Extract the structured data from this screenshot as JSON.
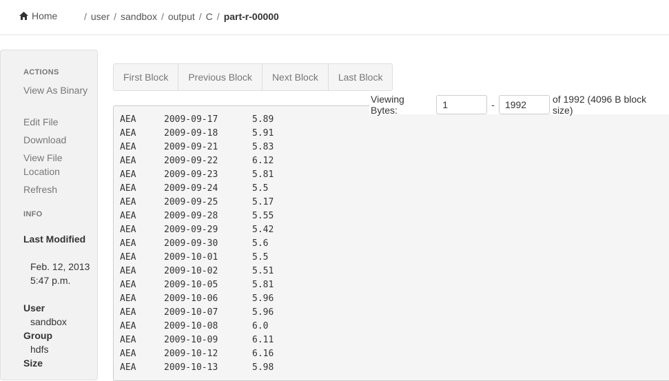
{
  "header": {
    "home_label": "Home",
    "breadcrumbs": [
      {
        "label": "user"
      },
      {
        "label": "sandbox"
      },
      {
        "label": "output"
      },
      {
        "label": "C"
      }
    ],
    "current_file": "part-r-00000",
    "separator": "/"
  },
  "sidebar": {
    "actions_title": "ACTIONS",
    "actions": [
      "View As Binary",
      "Edit File",
      "Download",
      "View File Location",
      "Refresh"
    ],
    "info_title": "INFO",
    "info": {
      "last_modified_label": "Last Modified",
      "last_modified_value": "Feb. 12, 2013 5:47 p.m.",
      "user_label": "User",
      "user_value": "sandbox",
      "group_label": "Group",
      "group_value": "hdfs",
      "size_label": "Size"
    }
  },
  "pager": {
    "first": "First Block",
    "previous": "Previous Block",
    "next": "Next Block",
    "last": "Last Block"
  },
  "viewing": {
    "label": "Viewing Bytes:",
    "start": "1",
    "dash": "-",
    "end": "1992",
    "suffix": "of 1992 (4096 B block size)"
  },
  "file_rows": [
    [
      "AEA",
      "2009-09-17",
      "5.89"
    ],
    [
      "AEA",
      "2009-09-18",
      "5.91"
    ],
    [
      "AEA",
      "2009-09-21",
      "5.83"
    ],
    [
      "AEA",
      "2009-09-22",
      "6.12"
    ],
    [
      "AEA",
      "2009-09-23",
      "5.81"
    ],
    [
      "AEA",
      "2009-09-24",
      "5.5"
    ],
    [
      "AEA",
      "2009-09-25",
      "5.17"
    ],
    [
      "AEA",
      "2009-09-28",
      "5.55"
    ],
    [
      "AEA",
      "2009-09-29",
      "5.42"
    ],
    [
      "AEA",
      "2009-09-30",
      "5.6"
    ],
    [
      "AEA",
      "2009-10-01",
      "5.5"
    ],
    [
      "AEA",
      "2009-10-02",
      "5.51"
    ],
    [
      "AEA",
      "2009-10-05",
      "5.81"
    ],
    [
      "AEA",
      "2009-10-06",
      "5.96"
    ],
    [
      "AEA",
      "2009-10-07",
      "5.96"
    ],
    [
      "AEA",
      "2009-10-08",
      "6.0"
    ],
    [
      "AEA",
      "2009-10-09",
      "6.11"
    ],
    [
      "AEA",
      "2009-10-12",
      "6.16"
    ],
    [
      "AEA",
      "2009-10-13",
      "5.98"
    ]
  ],
  "icons": {
    "home": "home-icon"
  }
}
